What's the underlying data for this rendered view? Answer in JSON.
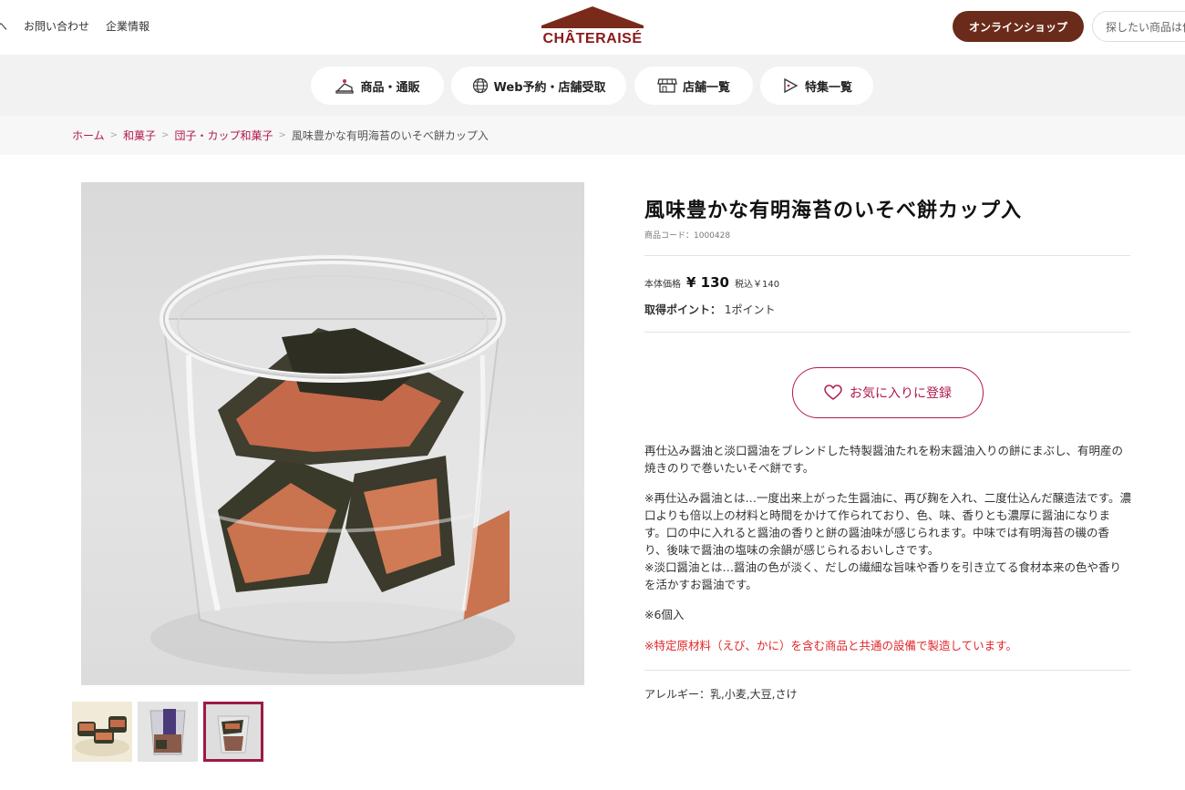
{
  "header": {
    "links": [
      "へ",
      "お問い合わせ",
      "企業情報"
    ],
    "logo_text": "CHÂTERAISÉ",
    "shop_button": "オンラインショップ",
    "search_placeholder": "探したい商品は何"
  },
  "catnav": {
    "items": [
      {
        "label": "商品・通販",
        "icon": "cake-icon"
      },
      {
        "label": "Web予約・店舗受取",
        "icon": "globe-icon"
      },
      {
        "label": "店舗一覧",
        "icon": "shop-icon"
      },
      {
        "label": "特集一覧",
        "icon": "play-icon"
      }
    ]
  },
  "breadcrumb": {
    "items": [
      "ホーム",
      "和菓子",
      "団子・カップ和菓子"
    ],
    "separator": ">",
    "current": "風味豊かな有明海苔のいそべ餅カップ入"
  },
  "product": {
    "title": "風味豊かな有明海苔のいそべ餅カップ入",
    "code": "商品コード：1000428",
    "price_label": "本体価格",
    "price": "¥ 130",
    "tax_price": "税込￥140",
    "points_label": "取得ポイント：",
    "points_value": "1ポイント",
    "favorite_button": "お気に入りに登録",
    "description": [
      "再仕込み醤油と淡口醤油をブレンドした特製醤油たれを粉末醤油入りの餅にまぶし、有明産の焼きのりで巻いたいそべ餅です。",
      "※再仕込み醤油とは…一度出来上がった生醤油に、再び麹を入れ、二度仕込んだ醸造法です。濃口よりも倍以上の材料と時間をかけて作られており、色、味、香りとも濃厚に醤油になります。口の中に入れると醤油の香りと餅の醤油味が感じられます。中味では有明海苔の磯の香り、後味で醤油の塩味の余韻が感じられるおいしさです。\n※淡口醤油とは…醤油の色が淡く、だしの繊細な旨味や香りを引き立てる食材本来の色や香りを活かすお醤油です。",
      "※6個入"
    ],
    "warning": "※特定原材料（えび、かに）を含む商品と共通の設備で製造しています。",
    "allergy": "アレルギー：乳,小麦,大豆,さけ"
  },
  "colors": {
    "accent": "#b01a4a",
    "brand_brown": "#6b2b1a",
    "logo_red": "#8a1a1a",
    "warning_red": "#e0262a"
  }
}
